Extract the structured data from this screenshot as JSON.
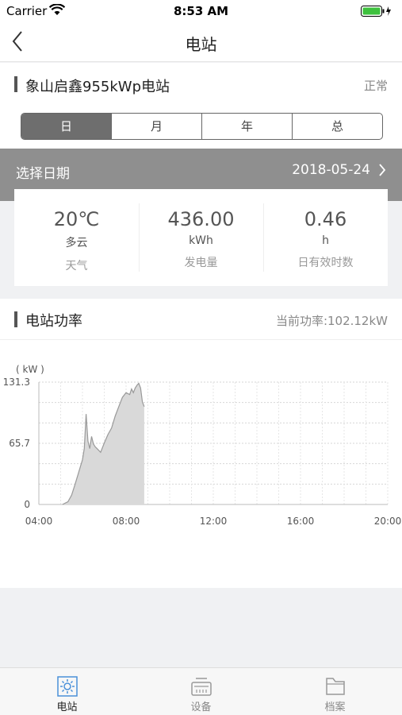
{
  "status_bar": {
    "carrier": "Carrier",
    "time": "8:53 AM"
  },
  "nav": {
    "title": "电站"
  },
  "station": {
    "name": "象山启鑫955kWp电站",
    "status": "正常"
  },
  "tabs": [
    "日",
    "月",
    "年",
    "总"
  ],
  "active_tab": "日",
  "date_select": {
    "label": "选择日期",
    "value": "2018-05-24"
  },
  "stats": [
    {
      "value": "20℃",
      "unit": "多云",
      "caption": "天气"
    },
    {
      "value": "436.00",
      "unit": "kWh",
      "caption": "发电量"
    },
    {
      "value": "0.46",
      "unit": "h",
      "caption": "日有效时数"
    }
  ],
  "power": {
    "title": "电站功率",
    "current": "当前功率:102.12kW"
  },
  "chart_data": {
    "type": "area",
    "ylabel": "( kW )",
    "ylim": [
      0,
      131.3
    ],
    "y_ticks": [
      "131.3",
      "65.7",
      "0"
    ],
    "x_ticks": [
      "04:00",
      "08:00",
      "12:00",
      "16:00",
      "20:00"
    ],
    "series": [
      {
        "x": [
          "05:05",
          "05:20",
          "05:30",
          "05:40",
          "05:50",
          "06:00",
          "06:05",
          "06:10",
          "06:15",
          "06:20",
          "06:25",
          "06:30",
          "06:35",
          "06:40",
          "06:50",
          "07:00",
          "07:10",
          "07:20",
          "07:30",
          "07:40",
          "07:50",
          "08:00",
          "08:10",
          "08:15",
          "08:20",
          "08:25",
          "08:30",
          "08:35",
          "08:40",
          "08:45",
          "08:50"
        ],
        "values": [
          0,
          3,
          10,
          22,
          35,
          48,
          60,
          97,
          68,
          60,
          73,
          65,
          62,
          60,
          56,
          66,
          75,
          82,
          95,
          105,
          115,
          120,
          118,
          124,
          120,
          125,
          128,
          130,
          125,
          110,
          105
        ]
      }
    ],
    "colors": {
      "fill": "#d9d9d9",
      "line": "#999999"
    }
  },
  "tabbar": [
    {
      "label": "电站",
      "icon": "sun-icon",
      "active": true
    },
    {
      "label": "设备",
      "icon": "inverter-icon",
      "active": false
    },
    {
      "label": "档案",
      "icon": "folder-icon",
      "active": false
    }
  ]
}
